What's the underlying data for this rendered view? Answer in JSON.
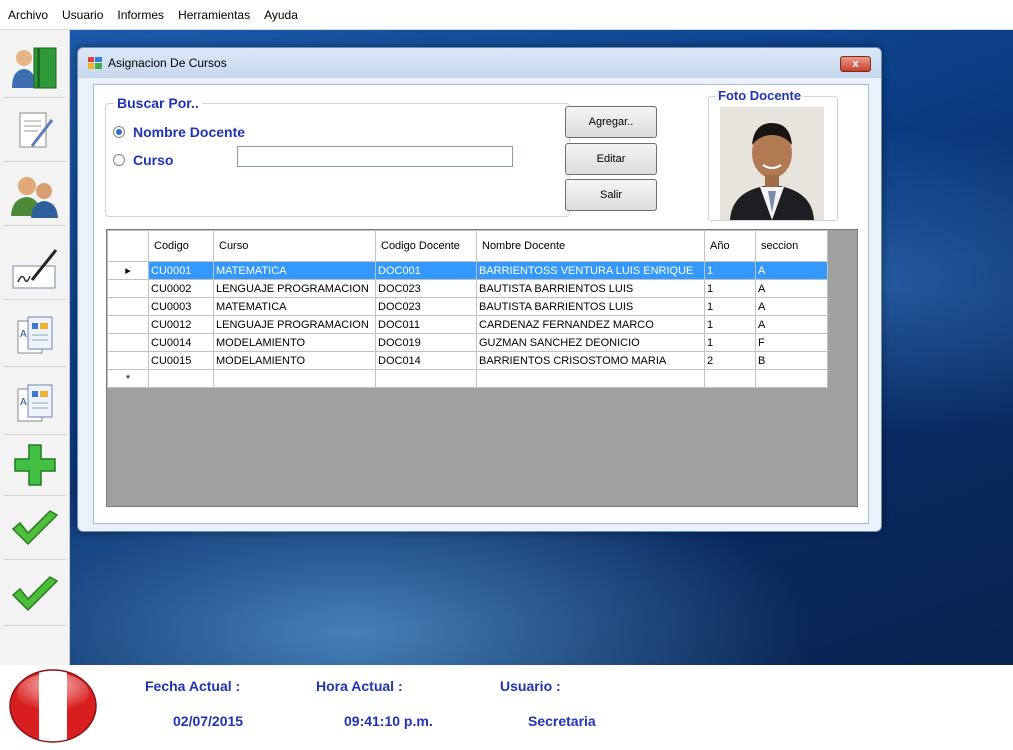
{
  "menu": [
    "Archivo",
    "Usuario",
    "Informes",
    "Herramientas",
    "Ayuda"
  ],
  "toolbar": {
    "items": [
      "docentes-book-icon",
      "document-pen-icon",
      "users-icon",
      "signature-icon",
      "report-icon",
      "report-icon",
      "add-icon",
      "check-icon",
      "check-icon"
    ]
  },
  "dialog": {
    "title": "Asignacion De Cursos",
    "close_label": "x",
    "search": {
      "legend": "Buscar Por..",
      "option_docente": "Nombre Docente",
      "option_curso": "Curso",
      "selected": "Nombre Docente",
      "input_value": "",
      "input_placeholder": ""
    },
    "buttons": {
      "agregar": "Agregar..",
      "editar": "Editar",
      "salir": "Salir"
    },
    "photo": {
      "legend": "Foto Docente"
    },
    "grid": {
      "columns": [
        "Codigo",
        "Curso",
        "Codigo Docente",
        "Nombre Docente",
        "Año",
        "seccion"
      ],
      "rows": [
        {
          "codigo": "CU0001",
          "curso": "MATEMATICA",
          "codigo_docente": "DOC001",
          "nombre_docente": "BARRIENTOSS VENTURA LUIS ENRIQUE",
          "anio": "1",
          "seccion": "A"
        },
        {
          "codigo": "CU0002",
          "curso": "LENGUAJE PROGRAMACION",
          "codigo_docente": "DOC023",
          "nombre_docente": "BAUTISTA BARRIENTOS LUIS",
          "anio": "1",
          "seccion": "A"
        },
        {
          "codigo": "CU0003",
          "curso": "MATEMATICA",
          "codigo_docente": "DOC023",
          "nombre_docente": "BAUTISTA BARRIENTOS LUIS",
          "anio": "1",
          "seccion": "A"
        },
        {
          "codigo": "CU0012",
          "curso": "LENGUAJE PROGRAMACION",
          "codigo_docente": "DOC011",
          "nombre_docente": "CARDENAZ FERNANDEZ MARCO",
          "anio": "1",
          "seccion": "A"
        },
        {
          "codigo": "CU0014",
          "curso": "MODELAMIENTO",
          "codigo_docente": "DOC019",
          "nombre_docente": "GUZMAN SANCHEZ DEONICIO",
          "anio": "1",
          "seccion": "F"
        },
        {
          "codigo": "CU0015",
          "curso": "MODELAMIENTO",
          "codigo_docente": "DOC014",
          "nombre_docente": "BARRIENTOS CRISOSTOMO MARIA",
          "anio": "2",
          "seccion": "B"
        }
      ],
      "selected_row": 0,
      "new_row_marker": "*",
      "current_row_marker": "▸"
    }
  },
  "status": {
    "fecha_label": "Fecha Actual :",
    "fecha_value": "02/07/2015",
    "hora_label": "Hora Actual :",
    "hora_value": "09:41:10 p.m.",
    "usuario_label": "Usuario :",
    "usuario_value": "Secretaria",
    "flag_icon": "peru-flag-button-icon"
  },
  "colors": {
    "label_blue": "#1f33b7",
    "selection": "#3399ff",
    "desktop_blue": "#0d3f88"
  }
}
